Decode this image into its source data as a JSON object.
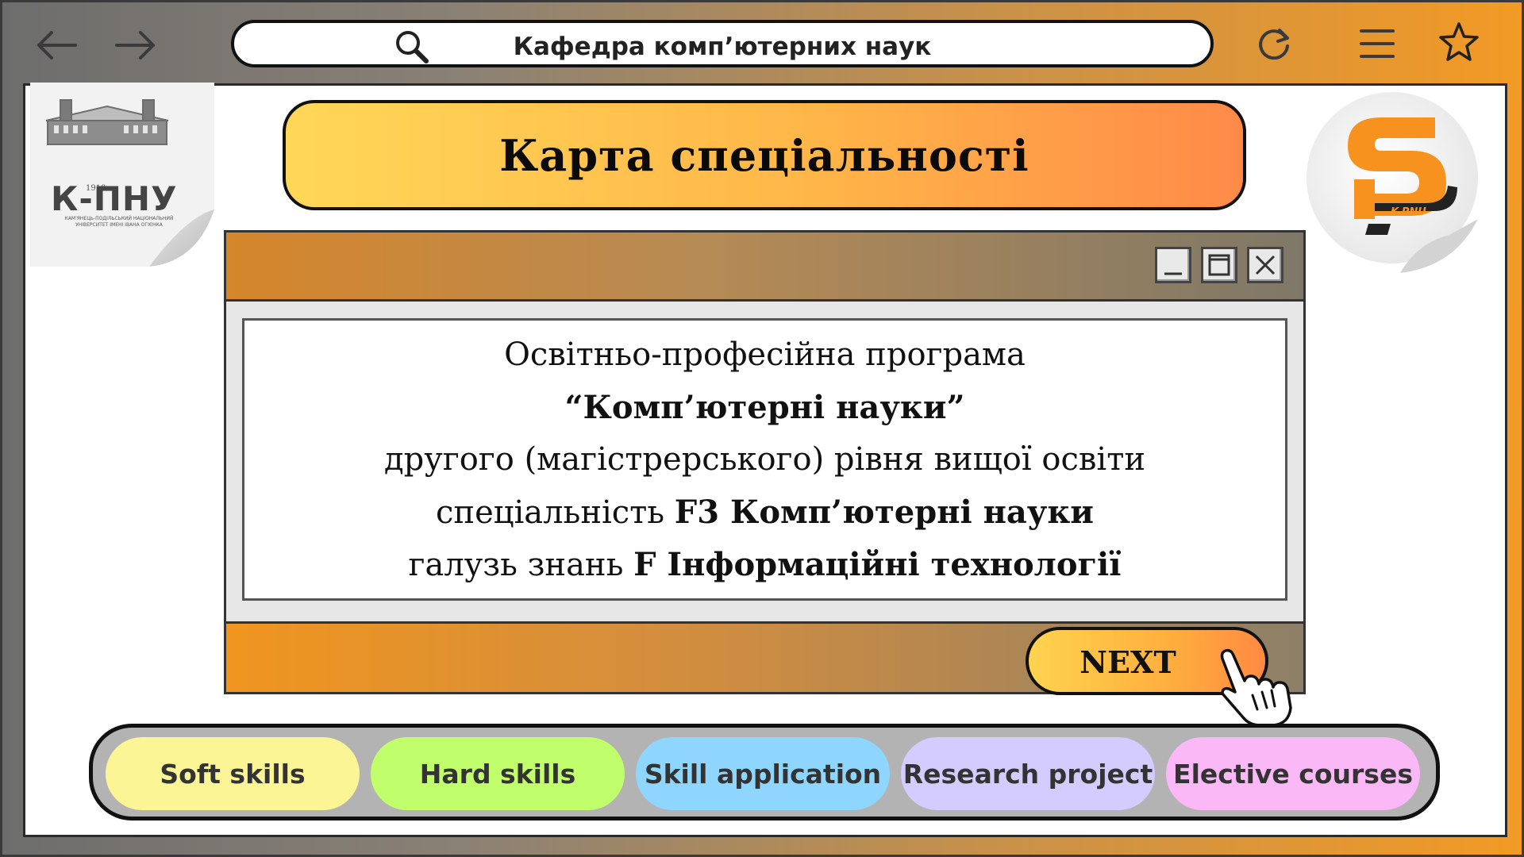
{
  "browser": {
    "url_title": "Кафедра комп’ютерних наук",
    "back_icon": "arrow-left-icon",
    "forward_icon": "arrow-right-icon",
    "reload_icon": "reload-icon",
    "menu_icon": "hamburger-menu-icon",
    "bookmark_icon": "star-icon"
  },
  "logos": {
    "left_year": "1918",
    "left_abbr": "К-ПНУ",
    "left_caption_1": "КАМ'ЯНЕЦЬ-ПОДІЛЬСЬКИЙ НАЦІОНАЛЬНИЙ",
    "left_caption_2": "УНІВЕРСИТЕТ ІМЕНІ ІВАНА ОГІЄНКА",
    "right_mark": "K-PNU"
  },
  "page": {
    "title": "Карта спеціальності"
  },
  "dialog": {
    "line1": "Освітньо-професійна програма",
    "line2": "“Комп’ютерні науки”",
    "line3": "другого (магістрерського) рівня вищої освіти",
    "line4_prefix": "спеціальність ",
    "line4_bold": "F3 Комп’ютерні науки",
    "line5_prefix": "галузь знань ",
    "line5_bold": "F Інформаційні технології",
    "next_label": "NEXT"
  },
  "tabs": [
    {
      "label": "Soft skills",
      "color": "#fbf595"
    },
    {
      "label": "Hard skills",
      "color": "#c0ff6b"
    },
    {
      "label": "Skill application",
      "color": "#8fd6ff"
    },
    {
      "label": "Research project",
      "color": "#d4ccff"
    },
    {
      "label": "Elective courses",
      "color": "#fbb8f7"
    }
  ],
  "colors": {
    "accent_orange": "#f29a25",
    "title_yellow": "#ffd758"
  }
}
